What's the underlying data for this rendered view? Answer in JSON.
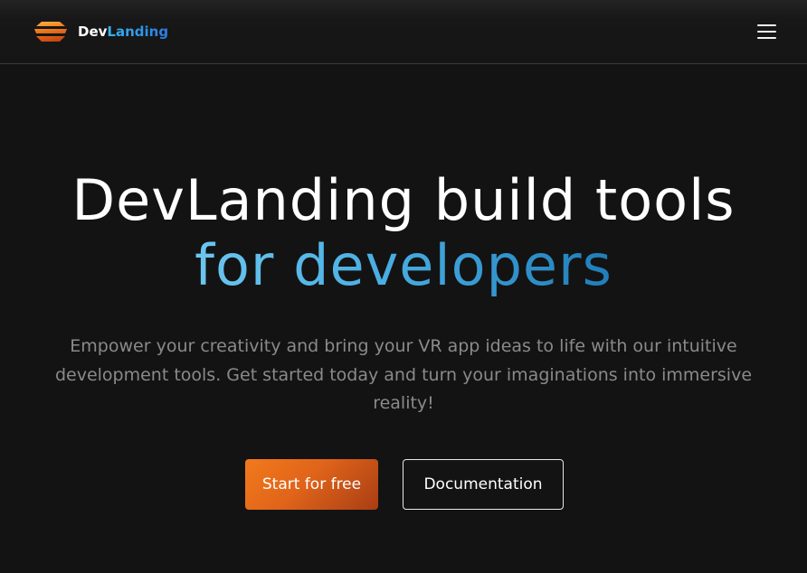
{
  "header": {
    "logo_part1": "Dev",
    "logo_part2": "Landing",
    "logo_icon": "layered-stack-logo-icon",
    "menu_icon": "hamburger-menu-icon"
  },
  "hero": {
    "title_line1": "DevLanding build tools",
    "title_line2": "for developers",
    "subtitle": "Empower your creativity and bring your VR app ideas to life with our intuitive development tools. Get started today and turn your imaginations into immersive reality!"
  },
  "cta": {
    "primary_label": "Start for free",
    "secondary_label": "Documentation"
  },
  "colors": {
    "background": "#131313",
    "accent_orange": "#f27a1c",
    "accent_blue": "#49aee3"
  }
}
